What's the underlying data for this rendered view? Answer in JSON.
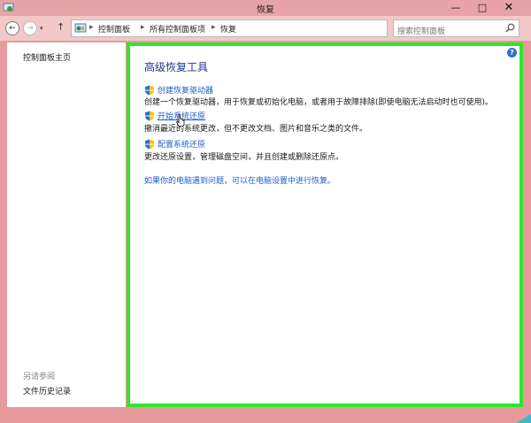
{
  "window": {
    "title": "恢复",
    "min_glyph": "—",
    "max_glyph": "□",
    "close_glyph": "✕"
  },
  "nav": {
    "back_glyph": "←",
    "forward_glyph": "→",
    "dropdown_glyph": "▾",
    "up_glyph": "↑",
    "refresh_glyph": "↻"
  },
  "address": {
    "crumbs": [
      "控制面板",
      "所有控制面板项",
      "恢复"
    ],
    "separator": "▸"
  },
  "search": {
    "placeholder": "搜索控制面板"
  },
  "sidebar": {
    "home_label": "控制面板主页",
    "see_also_label": "另请参阅",
    "file_history_label": "文件历史记录"
  },
  "main": {
    "heading": "高级恢复工具",
    "items": [
      {
        "link": "创建恢复驱动器",
        "desc": "创建一个恢复驱动器，用于恢复或初始化电脑，或者用于故障排除(即使电脑无法启动时也可使用)。"
      },
      {
        "link": "开始系统还原",
        "desc": "撤消最近的系统更改，但不更改文档、图片和音乐之类的文件。"
      },
      {
        "link": "配置系统还原",
        "desc": "更改还原设置，管理磁盘空间，并且创建或删除还原点。"
      }
    ],
    "bottom_link": "如果你的电脑遇到问题，可以在电脑设置中进行恢复。",
    "help_glyph": "?"
  },
  "colors": {
    "highlight_border": "#2ce82c",
    "link": "#1e5ec8",
    "heading": "#1b3a8a",
    "title_bar": "#e7a3a7"
  }
}
